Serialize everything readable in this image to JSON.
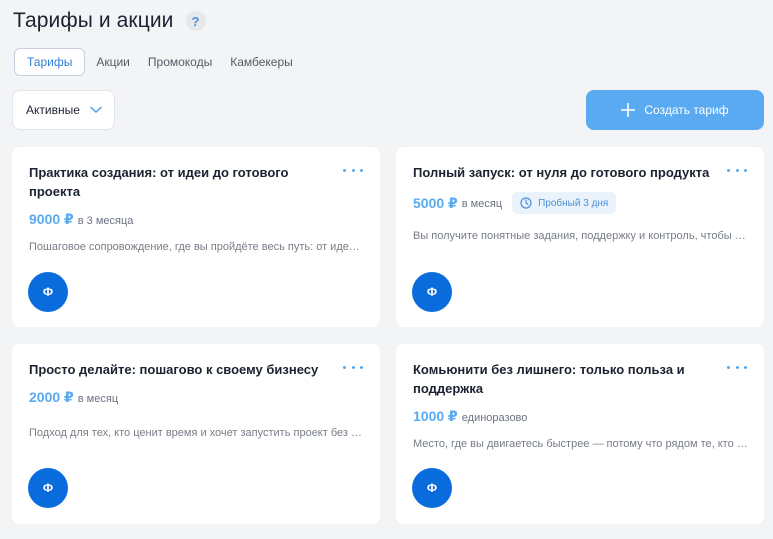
{
  "header": {
    "title": "Тарифы и акции",
    "help": "?"
  },
  "tabs": [
    {
      "label": "Тарифы",
      "active": true
    },
    {
      "label": "Акции",
      "active": false
    },
    {
      "label": "Промокоды",
      "active": false
    },
    {
      "label": "Камбекеры",
      "active": false
    }
  ],
  "filter": {
    "value": "Активные",
    "icon": "chevron-down-icon"
  },
  "create_button": {
    "label": "Создать тариф",
    "icon": "plus-icon"
  },
  "colors": {
    "accent": "#5aaaf2",
    "avatar": "#0a6cdc",
    "background": "#f3f4f6"
  },
  "cards": [
    {
      "title": "Практика создания: от идеи до готового проекта",
      "price": "9000 ₽",
      "period": "в 3 месяца",
      "description": "Пошаговое сопровождение, где вы пройдёте весь путь: от идеи до готового проекта",
      "avatar": "Ф"
    },
    {
      "title": "Полный запуск: от нуля до готового продукта",
      "price": "5000 ₽",
      "period": "в месяц",
      "trial": "Пробный 3 дня",
      "description": "Вы получите понятные задания, поддержку и контроль, чтобы дойти до результата",
      "avatar": "Ф"
    },
    {
      "title": "Просто делайте: пошагово к своему бизнесу",
      "price": "2000 ₽",
      "period": "в месяц",
      "description": "Подход для тех, кто ценит время и хочет запустить проект без лишней теории",
      "avatar": "Ф"
    },
    {
      "title": "Комьюнити без лишнего: только польза и поддержка",
      "price": "1000 ₽",
      "period": "единоразово",
      "description": "Место, где вы двигаетесь быстрее — потому что рядом те, кто идёт тем же путём",
      "avatar": "Ф"
    }
  ]
}
